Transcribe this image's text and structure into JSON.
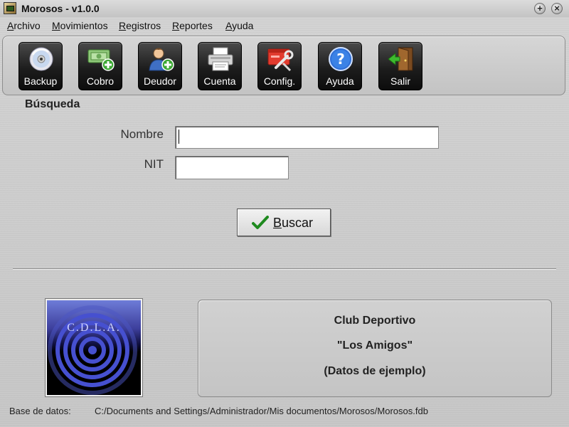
{
  "window": {
    "title": "Morosos - v1.0.0",
    "buttons": {
      "maximize": "+",
      "close": "×"
    }
  },
  "menu": [
    {
      "label": "Archivo",
      "accel": "A",
      "rest": "rchivo"
    },
    {
      "label": "Movimientos",
      "accel": "M",
      "rest": "ovimientos"
    },
    {
      "label": "Registros",
      "accel": "R",
      "rest": "egistros"
    },
    {
      "label": "Reportes",
      "accel": "R",
      "rest": "eportes"
    },
    {
      "label": "Ayuda",
      "accel": "A",
      "rest": "yuda"
    }
  ],
  "toolbar": [
    {
      "label": "Backup",
      "icon": "disc-icon"
    },
    {
      "label": "Cobro",
      "icon": "money-add-icon"
    },
    {
      "label": "Deudor",
      "icon": "user-add-icon"
    },
    {
      "label": "Cuenta",
      "icon": "printer-icon"
    },
    {
      "label": "Config.",
      "icon": "settings-tools-icon"
    },
    {
      "label": "Ayuda",
      "icon": "help-icon"
    },
    {
      "label": "Salir",
      "icon": "exit-door-icon"
    }
  ],
  "search": {
    "title": "Búsqueda",
    "nombre_label": "Nombre",
    "nombre_value": "",
    "nit_label": "NIT",
    "nit_value": "",
    "button_label": "Buscar",
    "button_accel": "B",
    "button_rest": "uscar"
  },
  "logo": {
    "text": "C.D.L.A."
  },
  "club": {
    "line1": "Club Deportivo",
    "line2": "\"Los Amigos\"",
    "line3": "(Datos de ejemplo)"
  },
  "status": {
    "label": "Base de datos:",
    "value": "C:/Documents and Settings/Administrador/Mis documentos/Morosos/Morosos.fdb"
  },
  "colors": {
    "window_bg": "#c9c9c9",
    "toolbar_button": "#1d1d1d",
    "check_green": "#1f8a1f",
    "logo_blue": "#3d3f9c"
  }
}
